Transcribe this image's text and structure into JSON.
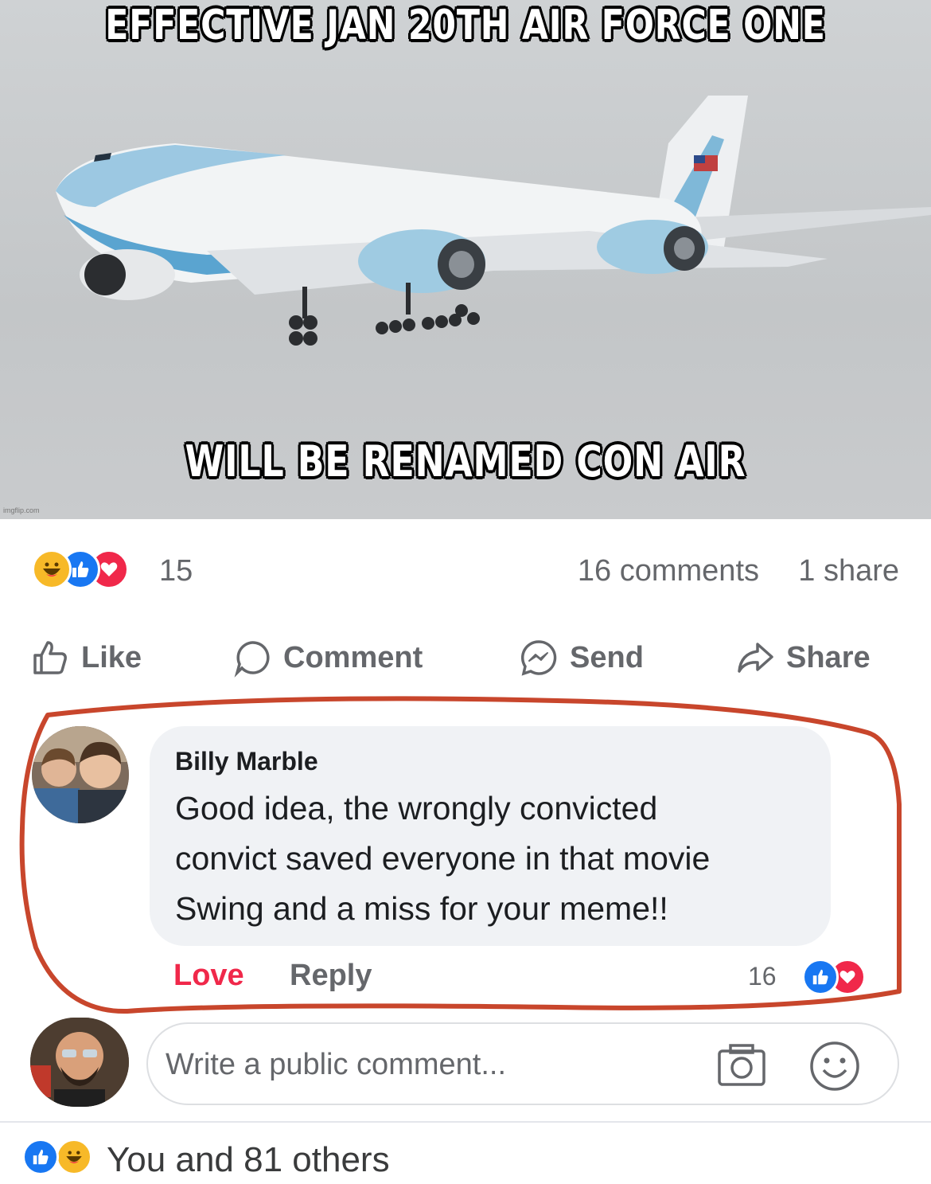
{
  "meme": {
    "top_caption": "EFFECTIVE JAN 20TH AIR FORCE ONE",
    "bottom_caption": "WILL BE RENAMED CON AIR",
    "watermark": "imgflip.com"
  },
  "post_stats": {
    "reactions": [
      "haha-icon",
      "like-icon",
      "love-icon"
    ],
    "reaction_count": "15",
    "comments": "16 comments",
    "shares": "1 share"
  },
  "actions": {
    "like": "Like",
    "comment": "Comment",
    "send": "Send",
    "share": "Share"
  },
  "comment": {
    "author": "Billy Marble",
    "lines": [
      "Good idea, the wrongly convicted",
      "convict saved everyone in that movie",
      "Swing and a miss for your meme!!"
    ],
    "love_label": "Love",
    "reply_label": "Reply",
    "reaction_count": "16",
    "reactions": [
      "like-icon",
      "love-icon"
    ],
    "annotation_color": "#c8462c"
  },
  "composer": {
    "placeholder": "Write a public comment..."
  },
  "footer": {
    "reactions": [
      "like-icon",
      "haha-icon"
    ],
    "text": "You and 81 others"
  },
  "colors": {
    "like_blue": "#1877f2",
    "love_red": "#f0284a",
    "haha_yellow": "#f7b928",
    "secondary_text": "#65676b"
  }
}
